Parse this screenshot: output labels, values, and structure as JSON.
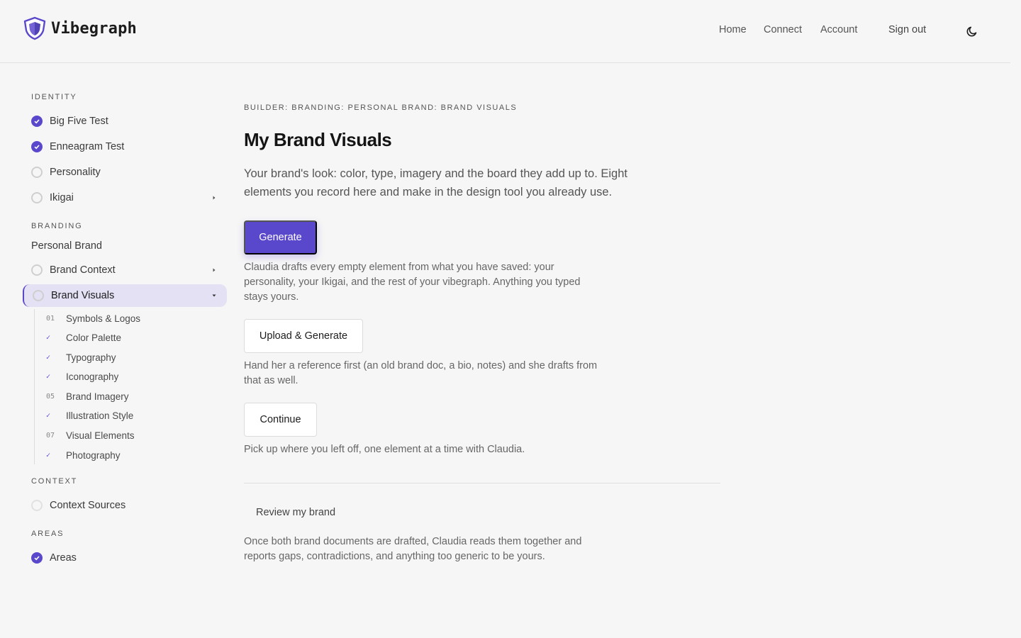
{
  "header": {
    "brand": "Vibegraph",
    "nav": {
      "home": "Home",
      "connect": "Connect",
      "account": "Account",
      "sign_out": "Sign out"
    },
    "theme_icon": "moon-icon"
  },
  "sidebar": {
    "identity": {
      "title": "IDENTITY",
      "items": [
        {
          "label": "Big Five Test",
          "status": "done"
        },
        {
          "label": "Enneagram Test",
          "status": "done"
        },
        {
          "label": "Personality",
          "status": "empty"
        },
        {
          "label": "Ikigai",
          "status": "empty",
          "expandable": true
        }
      ]
    },
    "branding": {
      "title": "BRANDING",
      "group": "Personal Brand",
      "items": [
        {
          "label": "Brand Context",
          "status": "empty",
          "expandable": true
        },
        {
          "label": "Brand Visuals",
          "status": "empty",
          "expanded": true,
          "active": true
        }
      ],
      "sub_items": [
        {
          "mark": "01",
          "label": "Symbols & Logos"
        },
        {
          "mark": "✓",
          "label": "Color Palette"
        },
        {
          "mark": "✓",
          "label": "Typography"
        },
        {
          "mark": "✓",
          "label": "Iconography"
        },
        {
          "mark": "05",
          "label": "Brand Imagery"
        },
        {
          "mark": "✓",
          "label": "Illustration Style"
        },
        {
          "mark": "07",
          "label": "Visual Elements"
        },
        {
          "mark": "✓",
          "label": "Photography"
        }
      ]
    },
    "context": {
      "title": "CONTEXT",
      "items": [
        {
          "label": "Context Sources",
          "status": "empty-light"
        }
      ]
    },
    "areas": {
      "title": "AREAS",
      "items": [
        {
          "label": "Areas",
          "status": "done"
        }
      ]
    }
  },
  "main": {
    "breadcrumb": "BUILDER: BRANDING: PERSONAL BRAND: BRAND VISUALS",
    "title": "My Brand Visuals",
    "intro": "Your brand's look: color, type, imagery and the board they add up to. Eight elements you record here and make in the design tool you already use.",
    "generate": {
      "label": "Generate",
      "desc": "Claudia drafts every empty element from what you have saved: your personality, your Ikigai, and the rest of your vibegraph. Anything you typed stays yours."
    },
    "upload": {
      "label": "Upload & Generate",
      "desc": "Hand her a reference first (an old brand doc, a bio, notes) and she drafts from that as well."
    },
    "continue": {
      "label": "Continue",
      "desc": "Pick up where you left off, one element at a time with Claudia."
    },
    "review": {
      "label": "Review my brand",
      "desc": "Once both brand documents are drafted, Claudia reads them together and reports gaps, contradictions, and anything too generic to be yours."
    }
  },
  "colors": {
    "accent": "#5a48cc",
    "active_bg": "#e4e1f5",
    "background": "#f6f6f6"
  }
}
